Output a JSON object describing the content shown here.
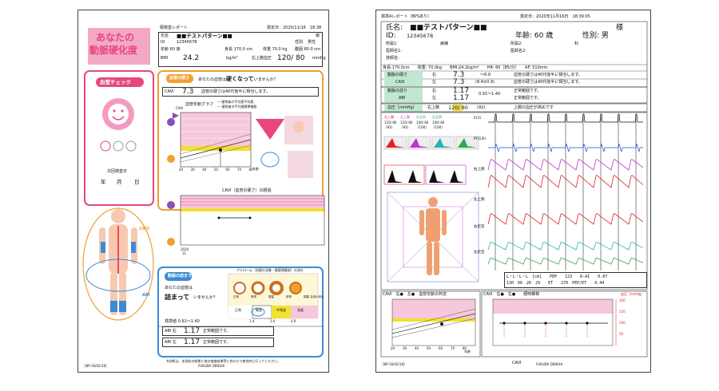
{
  "report1": {
    "title_line1": "あなたの",
    "title_line2": "動脈硬化度",
    "report_name": "頸検査レポート",
    "measure_date": "測定日：2020/11/16　18:38",
    "name_label": "氏名",
    "name_value": "■■テストパターン■■",
    "honorific": "様",
    "id_label": "ID",
    "id_value": "12345678",
    "sex_label": "性別",
    "sex_value": "男性",
    "age_row": "年齢 60 歳",
    "height_row": "身長 170.0 cm",
    "weight_row": "体重 70.0 kg",
    "waist_row": "腹囲 80.0 cm",
    "bmi_label": "BMI",
    "bmi_value": "24.2",
    "bmi_unit": "kg/m²",
    "bp_label": "右上腕血圧",
    "bp_value": "120/ 80",
    "bp_unit": "mmHg",
    "badge_check": "血管チェック",
    "next_exam_label": "次回検査日",
    "date_labels": [
      "年",
      "月",
      "日"
    ],
    "stiffness_badge": "血管の硬さ",
    "stiffness_question": "あなたの血管は",
    "stiffness_emph": "硬くなって",
    "stiffness_question_tail": "いませんか？",
    "cavi_label": "CAVI",
    "cavi_value": "7.3",
    "cavi_comment": "血管の硬さは40代後半に相当します。",
    "graph1_title": "血管年齢グラフ",
    "graph1_legend1": "— 健常者の平均値平均値",
    "graph1_legend2": "--- 健常者の平均値標準偏差",
    "graph1_axis_cavi": "CAVI",
    "graph1_axis_age": "年齢",
    "graph1_xticks": [
      "20",
      "30",
      "40",
      "50",
      "60",
      "70",
      "80"
    ],
    "graph2_title": "CAVI（血管の硬さ）の経過",
    "graph2_year": "2020",
    "graph2_month": "11",
    "cavi_body_label": "CAVI",
    "abi_body_label": "ABI",
    "clog_badge": "動脈の詰まり",
    "clog_question1": "あなたの血管は",
    "clog_question2": "詰まって",
    "clog_question_tail": "いませんか？",
    "athero_title": "アテローム（血管の沈着・脈管閉塞部）の流れ",
    "athero_stages": [
      "正常",
      "狭窄",
      "閉塞",
      "狭窄",
      "閉塞 血流の停止"
    ],
    "athero_cats": [
      "正常",
      "軽度",
      "中等度",
      "高度"
    ],
    "athero_ticks": [
      "1.4",
      "1.0",
      "0.9"
    ],
    "athero_marker": "正常",
    "std_range": "標準値 0.91〜1.40",
    "abi_right_label": "ABI 右",
    "abi_right_value": "1.17",
    "abi_right_comment": "正常範囲です。",
    "abi_left_label": "ABI 左",
    "abi_left_value": "1.17",
    "abi_left_comment": "正常範囲です。",
    "footnote": "※診断は、本測定の結果と他の検査結果等と合わせて総合的に行ってください。",
    "footer_id": "[BP-16/02/18]",
    "footer_company": "FUKUDA DENSHI"
  },
  "report2": {
    "report_name": "標準Aレポート（BPSあり）",
    "measure_date": "測定日：2020年11月16日　18:39:05",
    "name_label": "氏名:",
    "name_value": "■■テストパターン■■",
    "honorific": "様",
    "id_label": "ID:",
    "id_value": "12345678",
    "age_text": "年齢: 60 歳",
    "sex_text": "性別: 男",
    "dept_label1": "所属1:",
    "dept_value1": "病棟",
    "dept_label2": "所属2:",
    "dept_value2": "科",
    "doctor_label1": "医師名1:",
    "doctor_label2": "医師名2:",
    "tech_label": "技師名:",
    "vitals_line": "身長:170.0cm　　体重: 70.0kg　　BMI:24.2kg/m²　　HR: 60［85/分］　　AF: 510mm",
    "stiff_label": "動脈の硬さ",
    "cavi_label": "CAVI",
    "stiff_right": "右",
    "stiff_left": "左",
    "cavi_r": "7.3",
    "cavi_l": "7.3",
    "cavi_range1": "〜8.9",
    "cavi_range2": "(8.4±0.9)",
    "cavi_comment1": "血管の硬さは40代後半に相当します。",
    "cavi_comment2": "血管の硬さは40代後半に相当します。",
    "clog_label": "動脈の詰り",
    "abi_label": "ABI",
    "abi_r": "1.17",
    "abi_l": "1.17",
    "abi_range": "0.91〜1.40",
    "abi_comment1": "正常範囲です。",
    "abi_comment2": "正常範囲です。",
    "bp_label": "血圧［mmHg］",
    "bp_arm": "右上腕",
    "bp_value": "120/ 80",
    "bp_mean": "(92)",
    "bp_comment": "上腕の血圧が高めです",
    "bp_table_head": [
      "右上腕",
      "左上腕",
      "右足首",
      "左足首"
    ],
    "bp_table_rows": [
      "120/ 80",
      "120/ 80",
      "140/ 80",
      "140/ 80"
    ],
    "bp_table_mean": [
      "(92)",
      "(92)",
      "(100)",
      "(100)"
    ],
    "wave_labels": [
      "ECG",
      "PCG(Ⅱ)",
      "右上腕",
      "左上腕",
      "右足首",
      "左足首"
    ],
    "summary_row1": "L・L・L・L　[cm]　　PEP　　123　　R-AI　　0.87",
    "summary_row2": "130　66　26　29　　ET　　270　PEP/ET　　0.44",
    "graph_left_title": "CAVI　右●　左●　血管年齢の判定",
    "graph_left_xlabel": "年齢",
    "graph_left_xticks": [
      "20",
      "30",
      "40",
      "50",
      "60",
      "70",
      "80"
    ],
    "graph_right_title": "CAVI　右●　左●　　経時推移",
    "graph_right_unit": "血圧［mmHg］",
    "graph_right_yticks": [
      "200",
      "150",
      "100",
      "50"
    ],
    "footer_id": "[BP-16/02/18]",
    "footer_company": "FUKUDA DENSHI",
    "footer_cavi": "CAVI"
  },
  "colors": {
    "pink": "#e8467c",
    "orange": "#f0a030",
    "blue": "#3c8ad6",
    "green": "#2ea84a",
    "red": "#d22",
    "yellow": "#f2e032"
  }
}
